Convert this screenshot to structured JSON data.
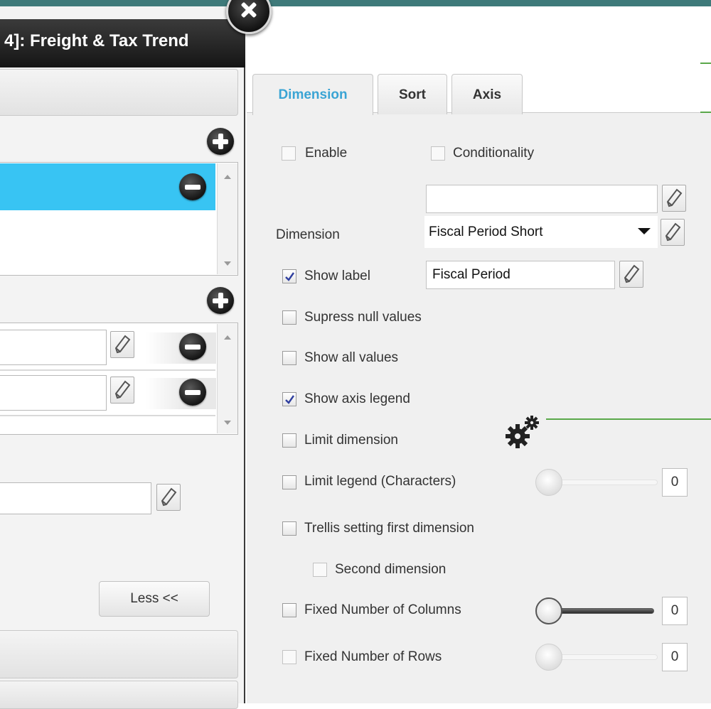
{
  "window": {
    "title": "4]: Freight & Tax Trend"
  },
  "left_panel": {
    "less_button": "Less <<",
    "list_1_items": [
      "",
      ""
    ],
    "list_2_rows": [
      "",
      ""
    ],
    "bottom_field_value": ""
  },
  "tabs": [
    {
      "label": "Dimension",
      "active": true
    },
    {
      "label": "Sort",
      "active": false
    },
    {
      "label": "Axis",
      "active": false
    }
  ],
  "form": {
    "enable": {
      "label": "Enable",
      "checked": false
    },
    "conditionality": {
      "label": "Conditionality",
      "checked": false
    },
    "condition_field_value": "",
    "dimension": {
      "label": "Dimension",
      "selected": "Fiscal Period Short"
    },
    "show_label": {
      "label": "Show label",
      "checked": true,
      "value": "Fiscal Period"
    },
    "suppress_null": {
      "label": "Supress null values",
      "checked": false
    },
    "show_all_values": {
      "label": "Show all values",
      "checked": false
    },
    "show_axis_legend": {
      "label": "Show axis legend",
      "checked": true
    },
    "limit_dimension": {
      "label": "Limit dimension",
      "checked": false
    },
    "limit_legend": {
      "label": "Limit legend (Characters)",
      "checked": false,
      "value": "0",
      "slider_fraction": 0
    },
    "trellis_first": {
      "label": "Trellis setting first dimension",
      "checked": false
    },
    "second_dimension": {
      "label": "Second dimension",
      "checked": false
    },
    "fixed_columns": {
      "label": "Fixed Number of Columns",
      "checked": false,
      "value": "0",
      "slider_fraction": 0
    },
    "fixed_rows": {
      "label": "Fixed Number of Rows",
      "checked": false,
      "value": "0",
      "slider_fraction": 0
    }
  },
  "colors": {
    "accent_tab": "#3aa4d4",
    "selection": "#38c4f3",
    "top_bar": "#3e7a7a",
    "guide_line": "#5aa84a"
  }
}
